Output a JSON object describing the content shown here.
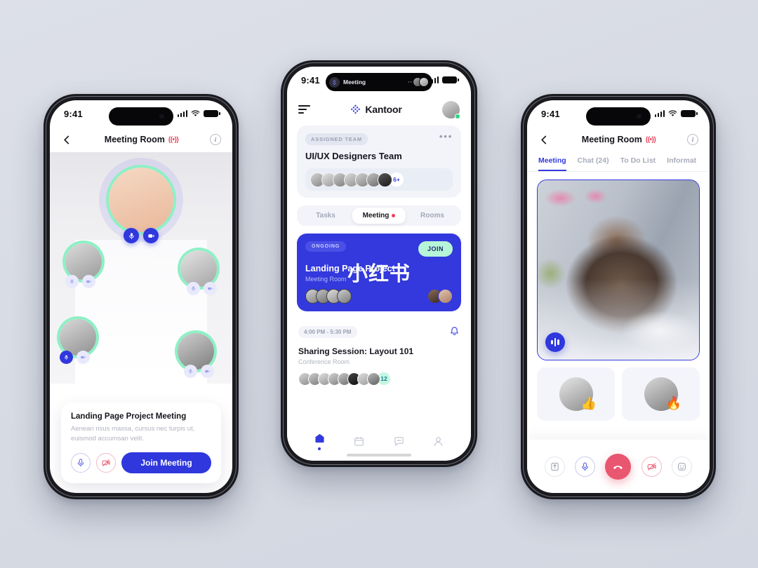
{
  "background_color": "#d9dde5",
  "accent_blue": "#3339dd",
  "accent_mint": "#8ef0c6",
  "accent_red": "#e8566f",
  "phone_left": {
    "status_bar": {
      "time": "9:41"
    },
    "nav": {
      "title": "Meeting Room",
      "live_badge": "((•))",
      "back_icon": "arrow-left-icon",
      "info_icon": "info-icon"
    },
    "host": {
      "mic_icon": "mic-icon",
      "camera_icon": "camera-icon"
    },
    "peers": [
      {
        "mic_active": false,
        "camera_active": false
      },
      {
        "mic_active": false,
        "camera_active": false
      },
      {
        "mic_active": true,
        "camera_active": false
      },
      {
        "mic_active": false,
        "camera_active": false
      }
    ],
    "card": {
      "title": "Landing Page Project Meeting",
      "description": "Aenean risus massa, cursus nec turpis ut, euismod accumsan velit.",
      "mic_icon": "mic-icon",
      "camera_off_icon": "camera-off-icon",
      "join_label": "Join Meeting"
    }
  },
  "phone_mid": {
    "status_bar": {
      "time": "9:41"
    },
    "dynamic_island": {
      "label": "Meeting",
      "app_icon": "kantoor-logo-icon"
    },
    "header": {
      "menu_icon": "hamburger-icon",
      "brand": "Kantoor",
      "avatar_icon": "user-avatar",
      "status": "online"
    },
    "team_card": {
      "chip": "ASSIGNED TEAM",
      "more_icon": "more-horizontal-icon",
      "name": "UI/UX Designers Team",
      "avatar_count": 7,
      "more_badge": "6+"
    },
    "segments": [
      {
        "label": "Tasks",
        "active": false,
        "dot": false
      },
      {
        "label": "Meeting",
        "active": true,
        "dot": true
      },
      {
        "label": "Rooms",
        "active": false,
        "dot": false
      }
    ],
    "ongoing_card": {
      "status_chip": "ONGOING",
      "join_label": "JOIN",
      "title": "Landing Page Project",
      "subtitle": "Meeting Room",
      "watermark": "小红书",
      "left_avatars": 4,
      "right_avatars": 2
    },
    "session_card": {
      "time": "4:00 PM - 5:30 PM",
      "bell_icon": "bell-icon",
      "title": "Sharing Session: Layout 101",
      "place": "Conference Room",
      "avatar_count": 8,
      "count_badge": "12"
    },
    "tabbar": [
      {
        "icon": "home-icon",
        "active": true
      },
      {
        "icon": "calendar-icon",
        "active": false
      },
      {
        "icon": "chat-icon",
        "active": false
      },
      {
        "icon": "profile-icon",
        "active": false
      }
    ]
  },
  "phone_right": {
    "status_bar": {
      "time": "9:41"
    },
    "nav": {
      "title": "Meeting Room",
      "live_badge": "((•))",
      "back_icon": "arrow-left-icon",
      "info_icon": "info-icon"
    },
    "tabs": [
      {
        "label": "Meeting",
        "active": true
      },
      {
        "label": "Chat (24)",
        "active": false
      },
      {
        "label": "To Do List",
        "active": false
      },
      {
        "label": "Informat",
        "active": false
      }
    ],
    "video": {
      "speaker_icon": "audio-waveform-icon"
    },
    "thumbs": [
      {
        "reaction": "👍"
      },
      {
        "reaction": "🔥"
      }
    ],
    "controls": [
      {
        "icon": "share-screen-icon",
        "style": "plain"
      },
      {
        "icon": "mic-icon",
        "style": "mic"
      },
      {
        "icon": "end-call-icon",
        "style": "end"
      },
      {
        "icon": "camera-off-icon",
        "style": "cam"
      },
      {
        "icon": "emoji-icon",
        "style": "plain"
      }
    ]
  }
}
